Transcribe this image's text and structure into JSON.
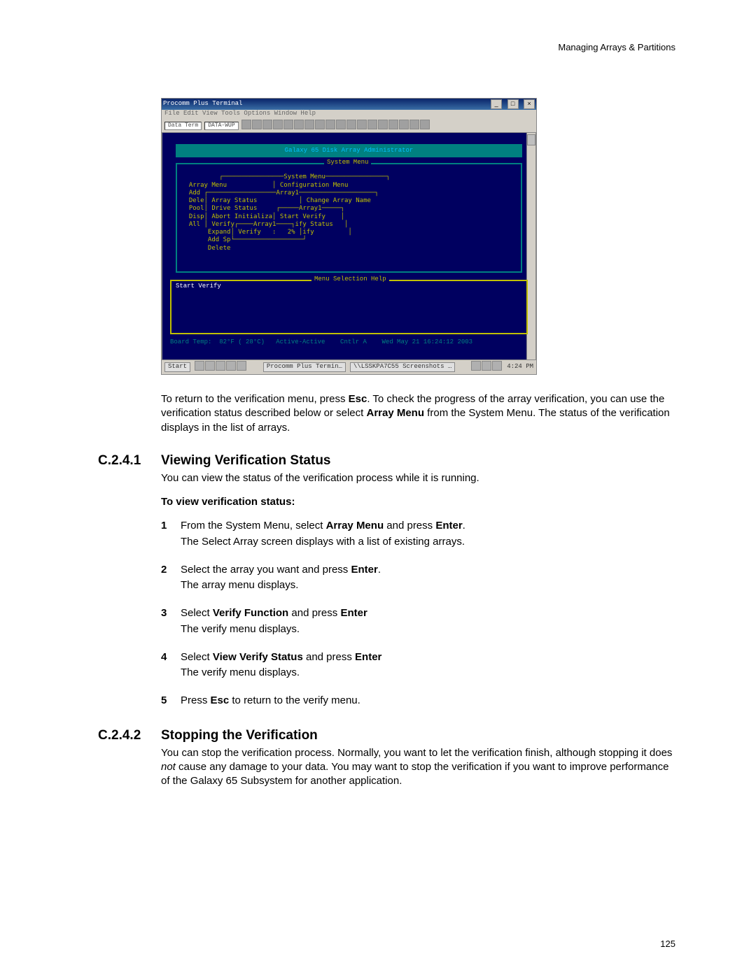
{
  "header": {
    "running": "Managing Arrays & Partitions"
  },
  "footer": {
    "page": "125"
  },
  "shot": {
    "window_title": "Procomm Plus Terminal",
    "menu_bar": "File  Edit  View  Tools  Options  Window  Help",
    "toolbar_field": "Data Term",
    "toolbar_combo": "DATA-WUP",
    "icon_count": 18,
    "term": {
      "banner": "Galaxy 65 Disk Array Administrator",
      "menus_pre": "          ┌────────────────System Menu────────────────┐\n  Array Menu            │ Configuration Menu\n  Add ┌──────────────────Array1────────────────────┐\n  Dele│ Array Status           │ Change Array Name\n  Pool│ Drive Status     ┌─────Array1─────┐\n  Disp│ Abort Initializa│ Start Verify    │\n  All │ Verify┌────Array1────┐ify Status   │\n       Expand│ Verify   :   2% │ify         │\n       Add Sp└──────────────────┘\n       Delete",
      "help_label": "Menu Selection Help",
      "help_line": "Start Verify",
      "status": "Board Temp:  82°F ( 28°C)   Active-Active    Cntlr A    Wed May 21 16:24:12 2003"
    },
    "taskbar": {
      "start": "Start",
      "task1": "Procomm Plus Termin…",
      "task2": "\\\\LSSKPA7C55 Screenshots …",
      "clock": "4:24 PM",
      "tray_icon_count": 5
    }
  },
  "para_intro_parts": {
    "a": "To return to the verification menu, press ",
    "esc": "Esc",
    "b": ". To check the progress of the array verification, you can use the verification status described below or select ",
    "arraymenu": "Array Menu",
    "c": " from the System Menu. The status of the verification displays in the list of arrays."
  },
  "sec1_num": "C.2.4.1",
  "sec1_title": "Viewing Verification Status",
  "sec1_intro": "You can view the status of the verification process while it is running.",
  "sec1_sub": "To view verification status:",
  "steps": {
    "s1a": "From the System Menu, select ",
    "s1a2": "Array Menu",
    "s1a3": " and press ",
    "s1a4": "Enter",
    "s1a5": ".",
    "s1b": "The Select Array screen displays with a list of existing arrays.",
    "s2a": "Select the array you want and press ",
    "s2a2": "Enter",
    "s2a3": ".",
    "s2b": "The array menu displays.",
    "s3a": "Select ",
    "s3a2": "Verify Function",
    "s3a3": " and press ",
    "s3a4": "Enter",
    "s3b": "The verify menu displays.",
    "s4a": "Select ",
    "s4a2": "View Verify Status",
    "s4a3": " and press ",
    "s4a4": "Enter",
    "s4b": "The verify menu displays.",
    "s5a": "Press ",
    "s5a2": "Esc",
    "s5a3": " to return to the verify menu."
  },
  "sec2_num": "C.2.4.2",
  "sec2_title": "Stopping the Verification",
  "sec2_para": {
    "a": "You can stop the verification process. Normally, you want to let the verification finish, although stopping it does ",
    "not": "not",
    "b": " cause any damage to your data. You may want to stop the verification if you want to improve performance of the Galaxy 65 Subsystem for another application."
  }
}
